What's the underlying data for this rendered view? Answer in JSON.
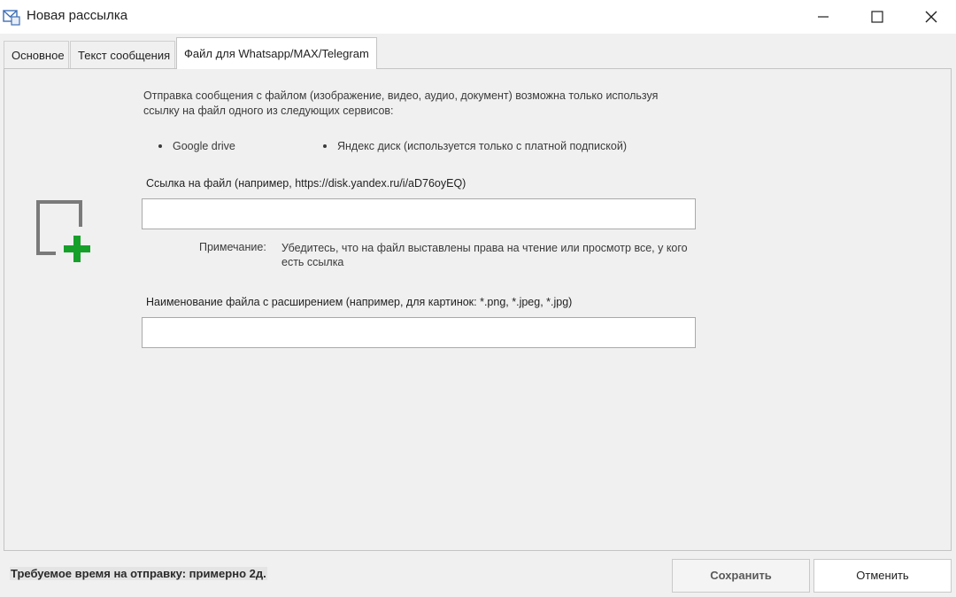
{
  "window": {
    "title": "Новая рассылка",
    "icon": "mail-app-icon",
    "controls": [
      "minimize-icon",
      "maximize-icon",
      "close-icon"
    ]
  },
  "tabs": [
    {
      "label": "Основное",
      "active": false
    },
    {
      "label": "Текст сообщения",
      "active": false
    },
    {
      "label": "Файл для Whatsapp/MAX/Telegram",
      "active": true
    }
  ],
  "panel": {
    "icon": "add-file-icon",
    "info_text": "Отправка сообщения с файлом (изображение, видео, аудио, документ) возможна только используя ссылку на файл одного из следующих сервисов:",
    "services": [
      "Google drive",
      "Яндекс диск (используется только с платной подпиской)"
    ],
    "link_field": {
      "label": "Ссылка на файл (например, https://disk.yandex.ru/i/aD76oyEQ)",
      "value": "",
      "placeholder": ""
    },
    "note": {
      "label": "Примечание:",
      "text": "Убедитесь, что на файл выставлены права на чтение или просмотр все, у кого есть ссылка"
    },
    "filename_field": {
      "label": "Наименование файла с расширением (например, для картинок: *.png, *.jpeg, *.jpg)",
      "value": "",
      "placeholder": ""
    }
  },
  "footer": {
    "time_text": "Требуемое время на отправку: примерно 2д.",
    "save_label": "Сохранить",
    "cancel_label": "Отменить"
  },
  "colors": {
    "accent_green": "#16a02a",
    "icon_gray": "#7a7a7a",
    "panel_bg": "#f0f0f0"
  }
}
